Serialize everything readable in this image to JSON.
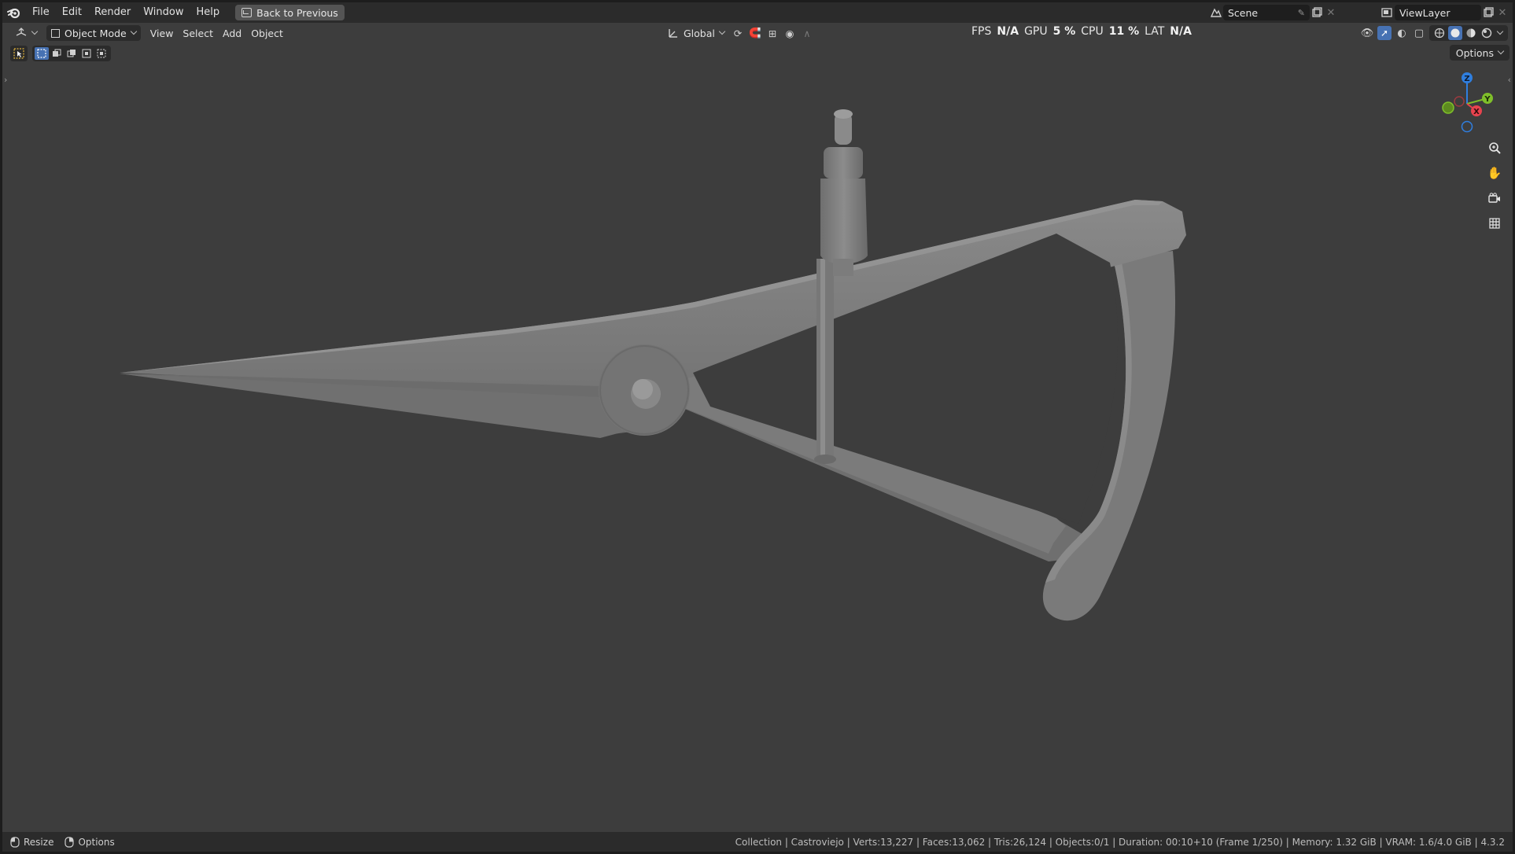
{
  "menubar": {
    "items": [
      "File",
      "Edit",
      "Render",
      "Window",
      "Help"
    ],
    "back_button": "Back to Previous",
    "scene_name": "Scene",
    "view_layer": "ViewLayer"
  },
  "viewport_header": {
    "mode": "Object Mode",
    "menus": [
      "View",
      "Select",
      "Add",
      "Object"
    ],
    "transform_orientation": "Global"
  },
  "stats": {
    "fps_label": "FPS",
    "fps_value": "N/A",
    "gpu_label": "GPU",
    "gpu_value": "5 %",
    "cpu_label": "CPU",
    "cpu_value": "11 %",
    "lat_label": "LAT",
    "lat_value": "N/A"
  },
  "options_label": "Options",
  "gizmo": {
    "z": "Z",
    "y": "Y",
    "x": "X"
  },
  "statusbar": {
    "resize_label": "Resize",
    "options_label": "Options",
    "info": "Collection | Castroviejo | Verts:13,227 | Faces:13,062 | Tris:26,124 | Objects:0/1 | Duration: 00:10+10 (Frame 1/250) | Memory: 1.32 GiB | VRAM: 1.6/4.0 GiB | 4.3.2"
  },
  "colors": {
    "viewport_bg": "#3d3d3d",
    "header_bg": "#2b2b2b",
    "accent_blue": "#4772b3",
    "axis_x": "#e8434e",
    "axis_y": "#7fbf2a",
    "axis_z": "#2f7fe0",
    "model_gray": "#7d7d7d"
  },
  "icons": {
    "app": "blender-logo-icon",
    "editor_type": "3d-viewport-icon",
    "zoom": "zoom-icon",
    "pan": "hand-icon",
    "camera": "camera-icon",
    "ortho": "grid-icon"
  }
}
